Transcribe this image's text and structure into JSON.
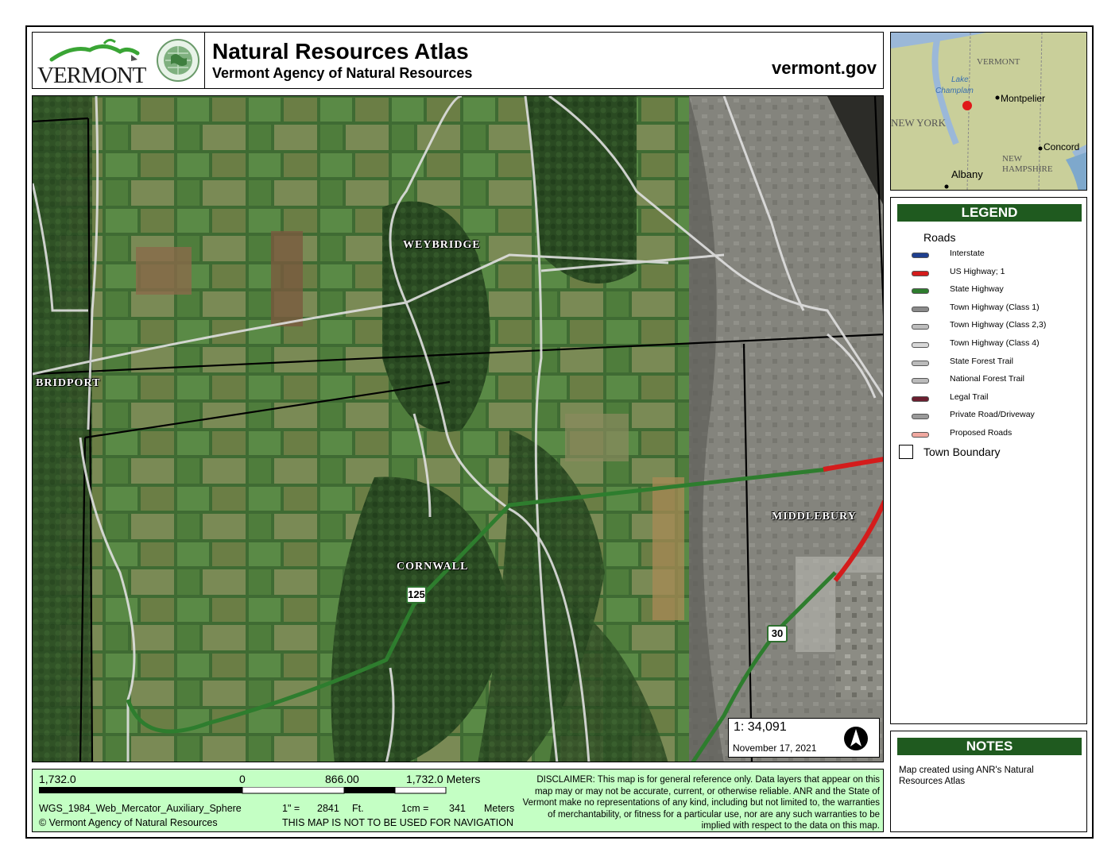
{
  "header": {
    "logo_text": "VERMONT",
    "title": "Natural Resources Atlas",
    "subtitle": "Vermont Agency of Natural Resources",
    "site": "vermont.gov"
  },
  "map": {
    "towns": [
      "WEYBRIDGE",
      "BRIDPORT",
      "CORNWALL",
      "MIDDLEBURY"
    ],
    "route_shields": [
      "125",
      "30"
    ],
    "scale": "1:  34,091",
    "date": "November 17, 2021"
  },
  "inset": {
    "labels": [
      "VERMONT",
      "Lake Champlain",
      "Montpelier",
      "NEW YORK",
      "NEW HAMPSHIRE",
      "Concord",
      "Albany"
    ]
  },
  "legend": {
    "title": "LEGEND",
    "group": "Roads",
    "items": [
      {
        "label": "Interstate",
        "color": "#1f3f8f"
      },
      {
        "label": "US Highway; 1",
        "color": "#d41c1c"
      },
      {
        "label": "State Highway",
        "color": "#2e7d2e"
      },
      {
        "label": "Town Highway (Class 1)",
        "color": "#8a8a8a"
      },
      {
        "label": "Town Highway (Class 2,3)",
        "color": "#bdbdbd"
      },
      {
        "label": "Town Highway (Class 4)",
        "color": "#d8d8d8"
      },
      {
        "label": "State Forest Trail",
        "color": "#bbbbbb"
      },
      {
        "label": "National Forest Trail",
        "color": "#bbbbbb"
      },
      {
        "label": "Legal Trail",
        "color": "#6b1f2f"
      },
      {
        "label": "Private Road/Driveway",
        "color": "#999999"
      },
      {
        "label": "Proposed Roads",
        "color": "#f0a8a0"
      }
    ],
    "town_boundary": "Town Boundary"
  },
  "notes": {
    "title": "NOTES",
    "text": "Map created using ANR's Natural Resources Atlas"
  },
  "footer": {
    "scale_left": "1,732.0",
    "scale_zero": "0",
    "scale_mid": "866.00",
    "scale_right": "1,732.0 Meters",
    "projection": "WGS_1984_Web_Mercator_Auxiliary_Sphere",
    "inch_label": "1\" =",
    "inch_value": "2841",
    "inch_unit": "Ft.",
    "cm_label": "1cm =",
    "cm_value": "341",
    "cm_unit": "Meters",
    "copyright": "© Vermont Agency of Natural Resources",
    "navigation": "THIS MAP IS NOT TO BE USED FOR NAVIGATION",
    "disclaimer": "DISCLAIMER: This map is for general reference only. Data layers that appear on this map may or may not be accurate, current, or otherwise reliable. ANR and the State of Vermont make no representations of any kind, including but not limited to, the warranties of merchantability, or fitness for a particular use, nor are any such warranties to be implied with respect to the data on this map."
  }
}
